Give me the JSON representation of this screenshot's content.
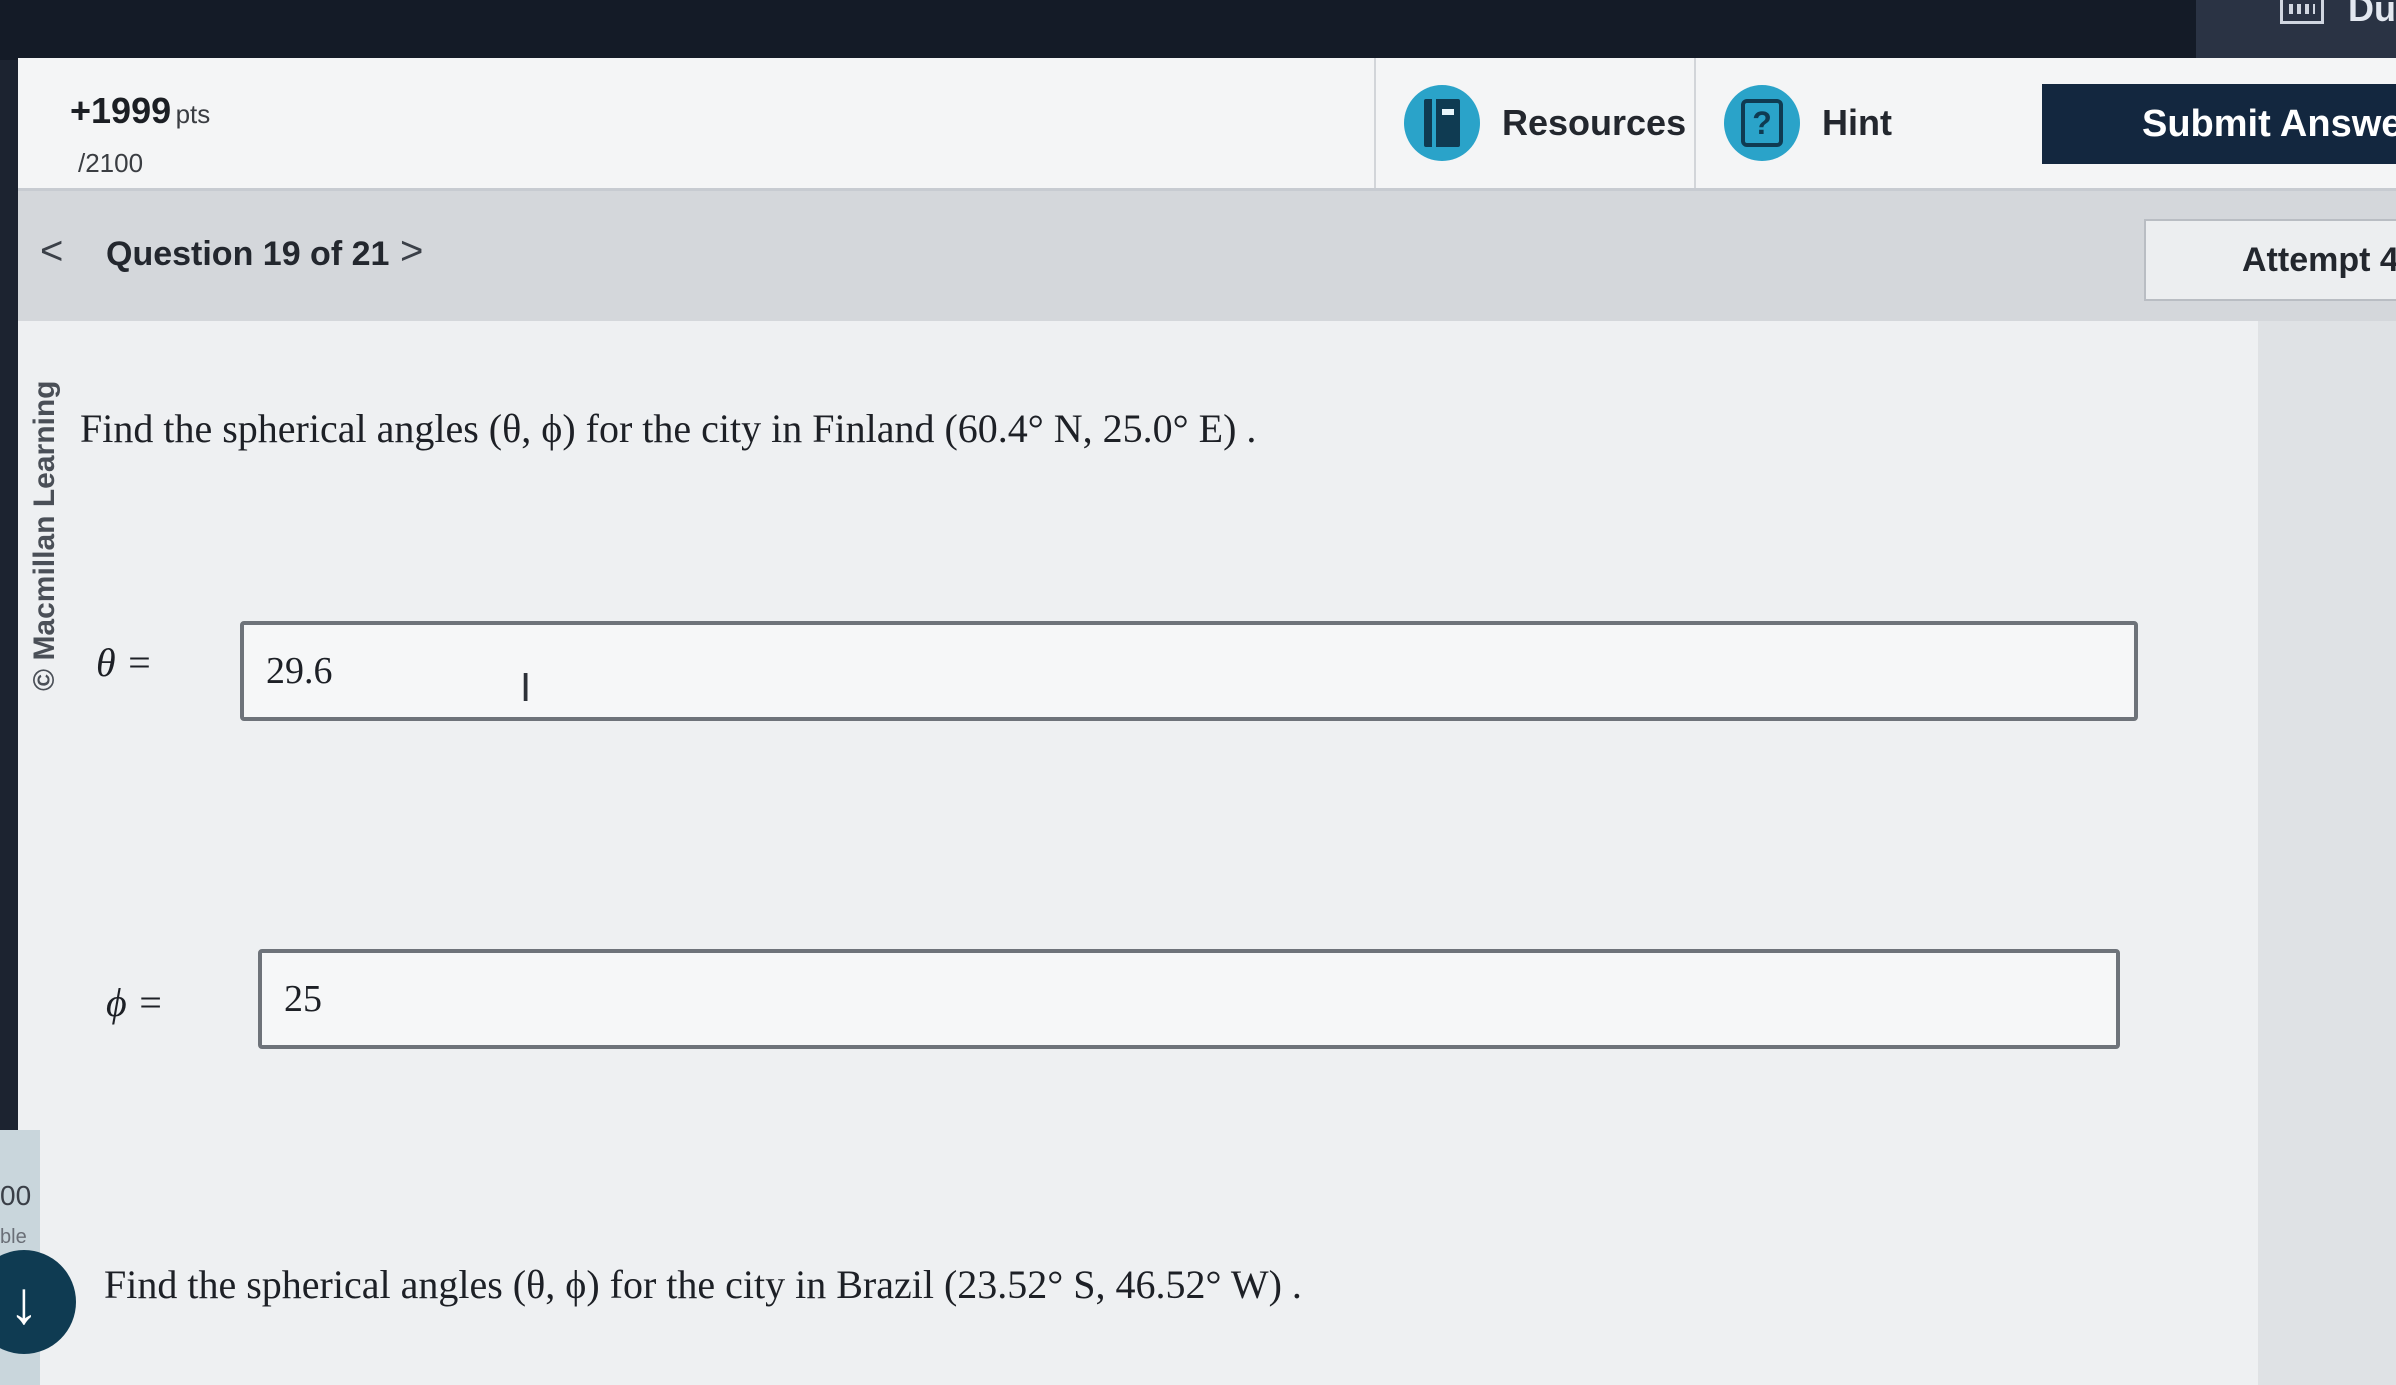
{
  "top_right": {
    "text": "Du"
  },
  "header": {
    "points": "+1999",
    "points_unit": "pts",
    "points_total": "/2100",
    "resources_label": "Resources",
    "hint_label": "Hint",
    "hint_glyph": "?",
    "submit_label": "Submit Answer"
  },
  "nav": {
    "prev_glyph": "<",
    "title": "Question 19 of 21",
    "next_glyph": ">",
    "attempt_label": "Attempt 4"
  },
  "content": {
    "copyright": "© Macmillan Learning",
    "question1": "Find the spherical angles (θ, ϕ) for the city in Finland (60.4° N, 25.0° E) .",
    "theta_label": "θ =",
    "theta_value": "29.6",
    "phi_label": "ϕ =",
    "phi_value": "25",
    "question2": "Find the spherical angles (θ, ϕ) for the city in Brazil (23.52° S, 46.52° W) ."
  },
  "left_edge": {
    "number": "00",
    "sub": "ble"
  },
  "icons": {
    "resources": "book-icon",
    "hint": "question-box-icon",
    "calendar": "calendar-icon",
    "down": "arrow-down-icon",
    "cursor": "text-cursor-icon"
  }
}
